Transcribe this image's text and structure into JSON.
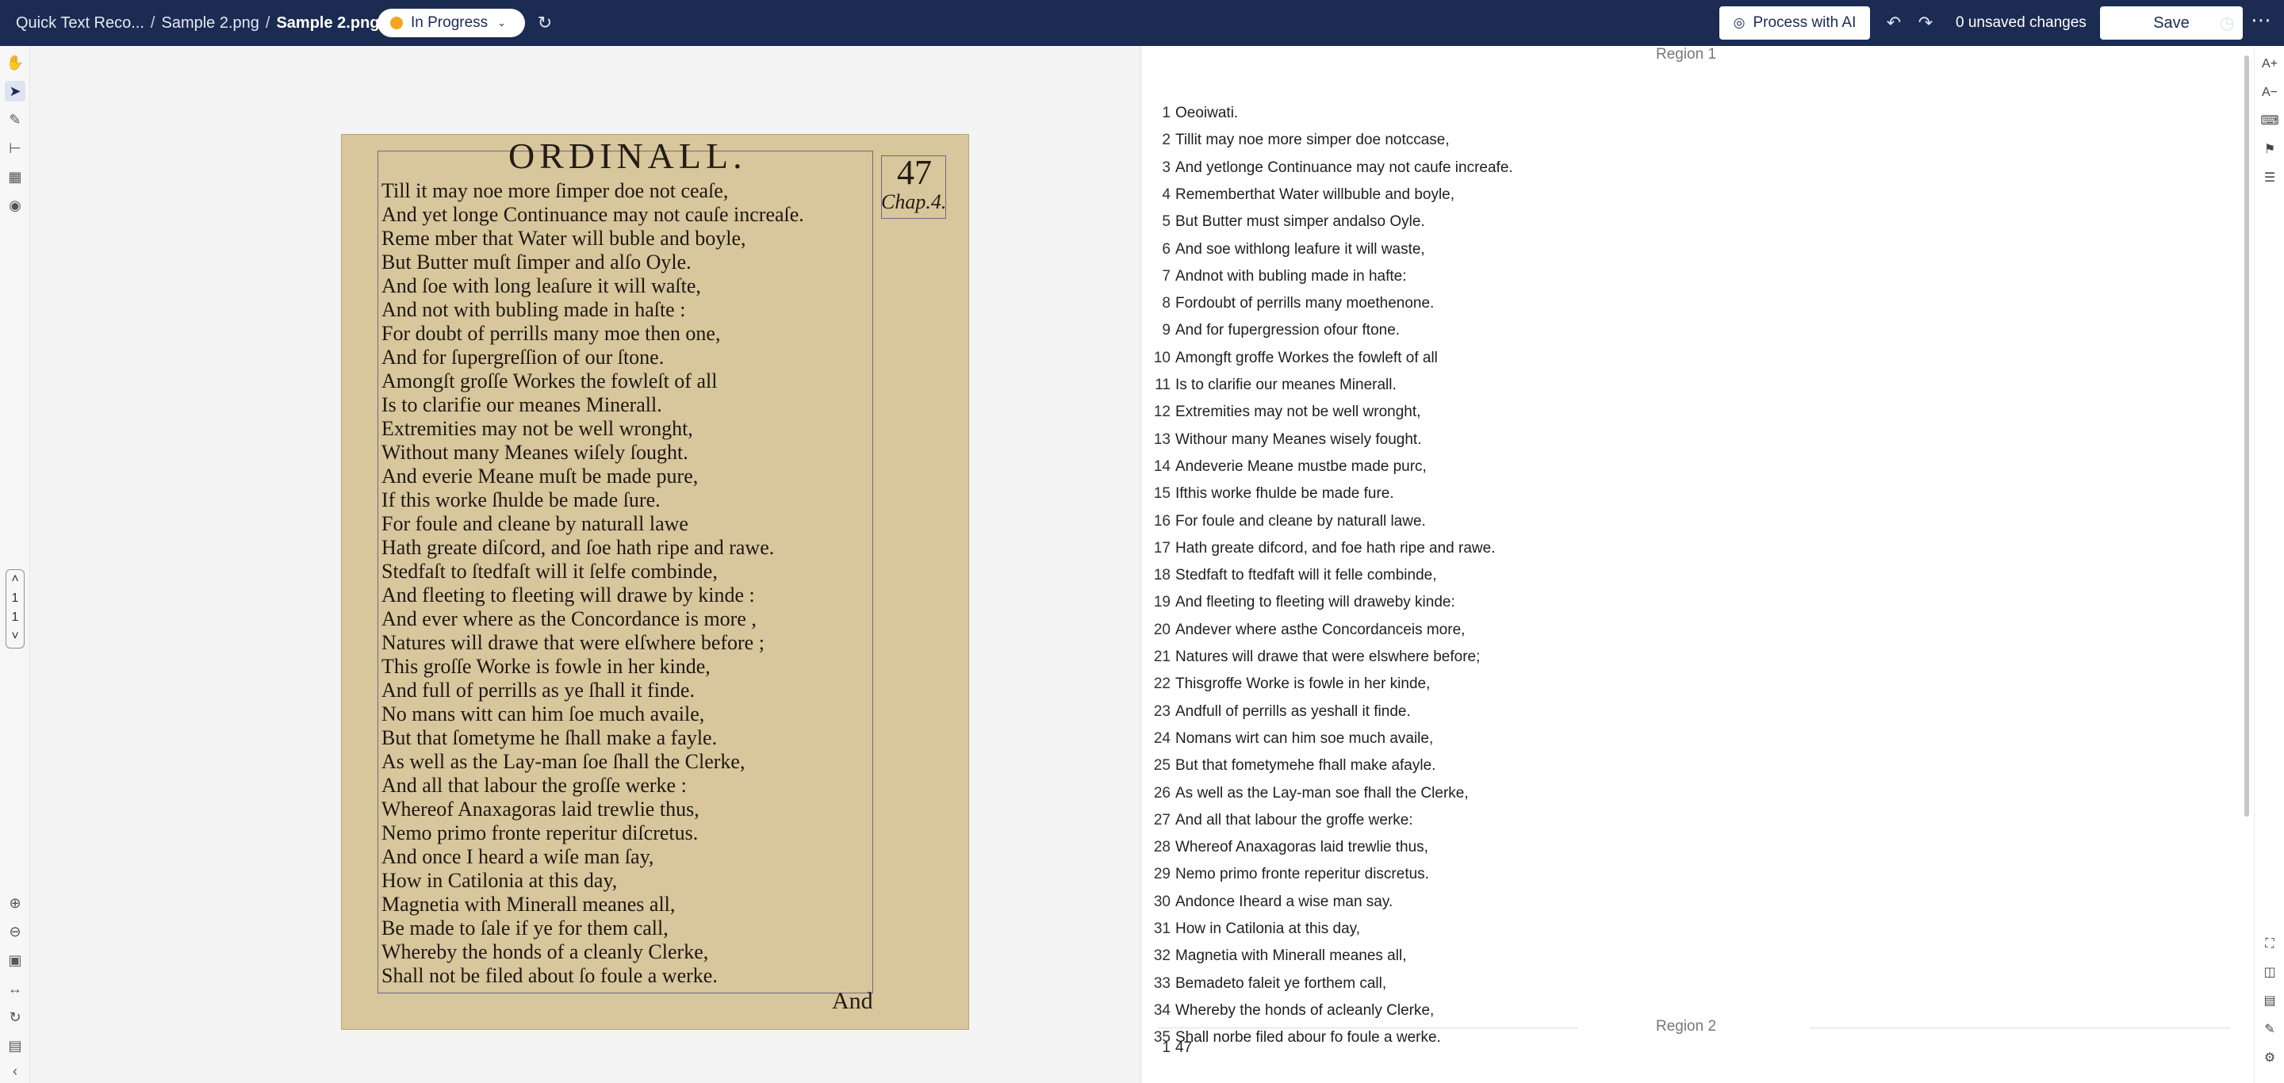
{
  "header": {
    "breadcrumb": [
      "Quick Text Reco...",
      "Sample 2.png",
      "Sample 2.png"
    ],
    "status": "In Progress",
    "process_label": "Process with AI",
    "unsaved": "0 unsaved changes",
    "save_label": "Save"
  },
  "pager": {
    "current": "1",
    "total": "1"
  },
  "document": {
    "title": "ORDINALL.",
    "page_number": "47",
    "chapter": "Chap.4.",
    "catchword": "And",
    "lines": [
      "Till it may noe more ſimper doe not ceaſe,",
      "And yet longe Continuance may not cauſe increaſe.",
      "Reme mber that Water will buble and boyle,",
      "But Butter muſt ſimper and alſo Oyle.",
      "And ſoe with long leaſure it will waſte,",
      "And not with bubling made in haſte :",
      "For doubt of perrills many moe then one,",
      "And for ſupergreſſion of our ſtone.",
      "Amongſt groſſe Workes the fowleſt of all",
      "Is to clarifie our meanes Minerall.",
      "Extremities may not be well wronght,",
      "Without many Meanes wiſely ſought.",
      "And everie Meane muſt be made pure,",
      "If this worke ſhulde be made ſure.",
      "For foule and cleane by naturall lawe",
      "Hath greate diſcord, and ſoe hath ripe and rawe.",
      "Stedfaſt to ſtedfaſt will it ſelfe combinde,",
      "And fleeting to fleeting will drawe by kinde :",
      "And ever where as the Concordance is more ,",
      "Natures will drawe that were elſwhere before ;",
      "This groſſe Worke is fowle in her kinde,",
      "And full of perrills as ye ſhall it finde.",
      "No mans witt can him ſoe much availe,",
      "But that ſometyme he ſhall make a fayle.",
      "As well as the Lay-man ſoe ſhall the Clerke,",
      "And all that labour the groſſe werke :",
      "Whereof Anaxagoras laid trewlie thus,",
      "Nemo primo fronte reperitur diſcretus.",
      "And once I heard a wiſe man ſay,",
      "How in Catilonia at this day,",
      "Magnetia with Minerall meanes all,",
      "Be made to ſale if ye for them call,",
      "Whereby the honds of a cleanly Clerke,",
      "Shall not be filed about ſo foule a werke."
    ]
  },
  "transcription": {
    "region1_label": "Region 1",
    "region2_label": "Region 2",
    "region1_lines": [
      "Oeoiwati.",
      "Tillit may noe more simper doe notccase,",
      "And yetlonge Continuance may not caufe increafe.",
      "Rememberthat Water willbuble and boyle,",
      "But Butter must simper andalso Oyle.",
      "And soe withlong leafure it will waste,",
      "Andnot with bubling made in hafte:",
      "Fordoubt of perrills many moethenone.",
      "And for fupergression ofour ftone.",
      "Amongft groffe Workes the fowleft of all",
      "Is to clarifie our meanes Minerall.",
      "Extremities may not be well wronght,",
      "Withour many Meanes wisely fought.",
      "Andeverie Meane mustbe made purc,",
      "Ifthis worke fhulde be made fure.",
      "For foule and cleane by naturall lawe.",
      "Hath greate difcord, and foe hath ripe and rawe.",
      "Stedfaft to ftedfaft will it felle combinde,",
      "And fleeting to fleeting will draweby kinde:",
      "Andever where asthe Concordanceis more,",
      "Natures will drawe that were elswhere before;",
      "Thisgroffe Worke is fowle in her kinde,",
      "Andfull of perrills as yeshall it finde.",
      "Nomans wirt can him soe much availe,",
      "But that fometymehe fhall make afayle.",
      "As well as the Lay-man soe fhall the Clerke,",
      "And all that labour the groffe werke:",
      "Whereof Anaxagoras laid trewlie thus,",
      "Nemo primo fronte reperitur discretus.",
      "Andonce Iheard a wise man say.",
      "How in Catilonia at this day,",
      "Magnetia with Minerall meanes all,",
      "Bemadeto faleit ye forthem call,",
      "Whereby the honds of acleanly Clerke,",
      "Shall norbe filed abour fo foule a werke."
    ],
    "region2_lines": [
      "47"
    ]
  }
}
